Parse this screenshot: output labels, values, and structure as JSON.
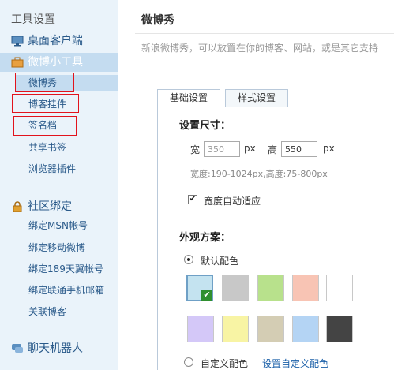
{
  "sidebar": {
    "title": "工具设置",
    "groups": [
      {
        "label": "桌面客户端",
        "icon": "monitor-icon"
      },
      {
        "label": "微博小工具",
        "icon": "toolbox-icon"
      },
      {
        "label": "社区绑定",
        "icon": "lock-icon"
      },
      {
        "label": "聊天机器人",
        "icon": "chat-icon"
      }
    ],
    "tools_items": [
      "微博秀",
      "博客挂件",
      "签名档",
      "共享书签",
      "浏览器插件"
    ],
    "community_items": [
      "绑定MSN帐号",
      "绑定移动微博",
      "绑定189天翼帐号",
      "绑定联通手机邮箱",
      "关联博客"
    ]
  },
  "main": {
    "title": "微博秀",
    "description": "新浪微博秀，可以放置在你的博客、网站，或是其它支持",
    "tabs": [
      "基础设置",
      "样式设置"
    ],
    "size_section": {
      "title": "设置尺寸：",
      "width_label": "宽",
      "width_value": "350",
      "width_unit": "px",
      "height_label": "高",
      "height_value": "550",
      "height_unit": "px",
      "hint": "宽度:190-1024px,高度:75-800px",
      "auto_width_label": "宽度自动适应",
      "auto_width_checked": true
    },
    "appearance_section": {
      "title": "外观方案：",
      "default_label": "默认配色",
      "custom_label": "自定义配色",
      "custom_link": "设置自定义配色",
      "swatches": [
        "#c4e3f0",
        "#c8c8c8",
        "#b8e18c",
        "#f8c4b4",
        "#ffffff",
        "#d4c8f8",
        "#f8f4a4",
        "#d4cdb4",
        "#b4d4f4",
        "#444444"
      ],
      "selected_index": 0
    }
  }
}
